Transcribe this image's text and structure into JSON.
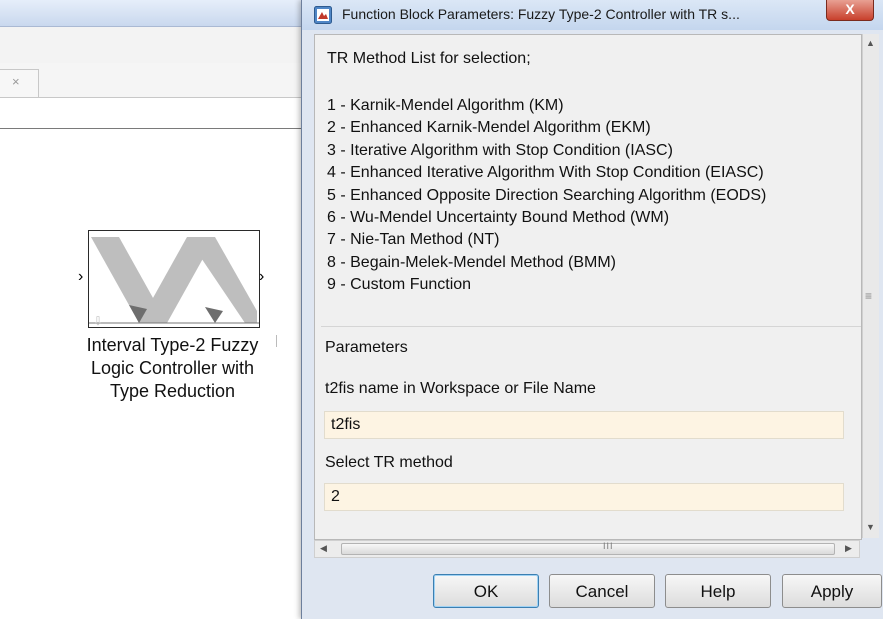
{
  "model_window": {
    "tab_close_glyph": "×",
    "block_label": "Interval Type-2 Fuzzy\nLogic Controller with\nType Reduction",
    "port_in_glyph": "›",
    "port_out_glyph": "›"
  },
  "dialog": {
    "title": "Function Block Parameters: Fuzzy Type-2 Controller with TR s...",
    "close_glyph": "X",
    "list_heading": "TR Method List for selection;",
    "tr_methods": [
      "1 - Karnik-Mendel Algorithm (KM)",
      "2 - Enhanced Karnik-Mendel Algorithm (EKM)",
      "3 - Iterative Algorithm with Stop Condition (IASC)",
      "4 - Enhanced Iterative Algorithm With Stop Condition (EIASC)",
      "5 - Enhanced Opposite Direction Searching Algorithm (EODS)",
      "6 - Wu-Mendel Uncertainty Bound Method (WM)",
      "7 - Nie-Tan Method (NT)",
      "8 - Begain-Melek-Mendel Method (BMM)",
      "9 - Custom Function"
    ],
    "parameters": {
      "section_label": "Parameters",
      "t2fis_label": "t2fis name in Workspace or File Name",
      "t2fis_value": "t2fis",
      "tr_method_label": "Select TR method",
      "tr_method_value": "2"
    },
    "scrollbar": {
      "up_glyph": "▲",
      "down_glyph": "▼",
      "left_glyph": "◀",
      "right_glyph": "▶",
      "v_grip": "≡",
      "h_grip": "III"
    },
    "buttons": {
      "ok": "OK",
      "cancel": "Cancel",
      "help": "Help",
      "apply": "Apply"
    }
  },
  "colors": {
    "input_background": "#fdf4e3",
    "close_button": "#c8402c",
    "default_button_border": "#3c7fb1"
  }
}
